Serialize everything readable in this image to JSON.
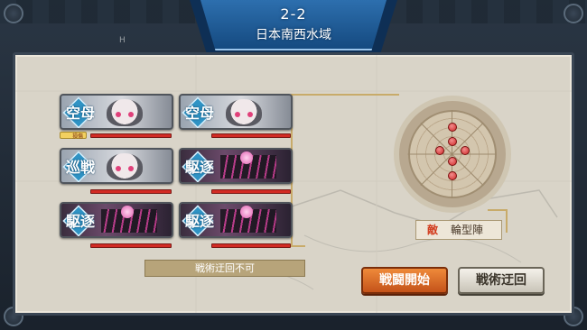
{
  "header": {
    "map_number": "2-2",
    "map_name": "日本南西水域"
  },
  "panel": {
    "grid_mark": "H"
  },
  "fleet": {
    "ships": [
      {
        "type": "空母",
        "class": "cv"
      },
      {
        "type": "空母",
        "class": "cv"
      },
      {
        "type": "巡戦",
        "class": "ca"
      },
      {
        "type": "駆逐",
        "class": "dd"
      },
      {
        "type": "駆逐",
        "class": "dd"
      },
      {
        "type": "駆逐",
        "class": "dd"
      }
    ],
    "condition_label": "損傷"
  },
  "info": {
    "retreat_status": "戦術迂回不可"
  },
  "enemy": {
    "label": "敵",
    "formation": "輪型陣",
    "dot_count": 6
  },
  "buttons": {
    "sortie": "戦闘開始",
    "retreat": "戦術迂回"
  },
  "colors": {
    "accent_blue": "#2d6fae",
    "hp_red": "#d22b24",
    "sortie_orange": "#e07a30"
  }
}
